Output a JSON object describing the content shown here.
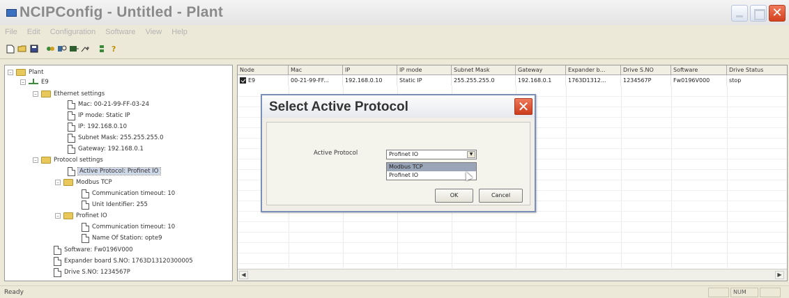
{
  "window": {
    "title": "NCIPConfig - Untitled - Plant",
    "close_glyph": "✕"
  },
  "menu": [
    "File",
    "Edit",
    "Configuration",
    "Software",
    "View",
    "Help"
  ],
  "toolbar_icons": [
    "new-file-icon",
    "open-folder-icon",
    "save-icon",
    "connect-icon",
    "find-icon",
    "download-icon",
    "upload-icon",
    "network-icon",
    "help-icon"
  ],
  "tree": {
    "root": "Plant",
    "node": "E9",
    "ethernet": {
      "label": "Ethernet settings",
      "mac": "Mac: 00-21-99-FF-03-24",
      "ipmode": "IP mode: Static IP",
      "ip": "IP: 192.168.0.10",
      "subnet": "Subnet Mask: 255.255.255.0",
      "gateway": "Gateway: 192.168.0.1"
    },
    "protocol": {
      "label": "Protocol settings",
      "active": "Active Protocol: Profinet IO",
      "modbus": {
        "label": "Modbus TCP",
        "timeout": "Communication timeout: 10",
        "unit": "Unit Identifier: 255"
      },
      "profinet": {
        "label": "Profinet IO",
        "timeout": "Communication timeout: 10",
        "station": "Name Of Station: opte9"
      }
    },
    "software": "Software: Fw0196V000",
    "expander": "Expander board S.NO: 1763D13120300005",
    "drive": "Drive S.NO: 1234567P"
  },
  "grid": {
    "headers": [
      "Node",
      "Mac",
      "IP",
      "IP mode",
      "Subnet Mask",
      "Gateway",
      "Expander b...",
      "Drive S.NO",
      "Software",
      "Drive Status"
    ],
    "row": [
      "E9",
      "00-21-99-FF...",
      "192.168.0.10",
      "Static IP",
      "255.255.255.0",
      "192.168.0.1",
      "1763D1312...",
      "1234567P",
      "Fw0196V000",
      "stop"
    ]
  },
  "dialog": {
    "title": "Select Active Protocol",
    "label": "Active Protocol",
    "selected": "Profinet IO",
    "options": [
      "Modbus TCP",
      "Profinet IO"
    ],
    "ok": "OK",
    "cancel": "Cancel"
  },
  "status": {
    "text": "Ready",
    "num": "NUM"
  }
}
